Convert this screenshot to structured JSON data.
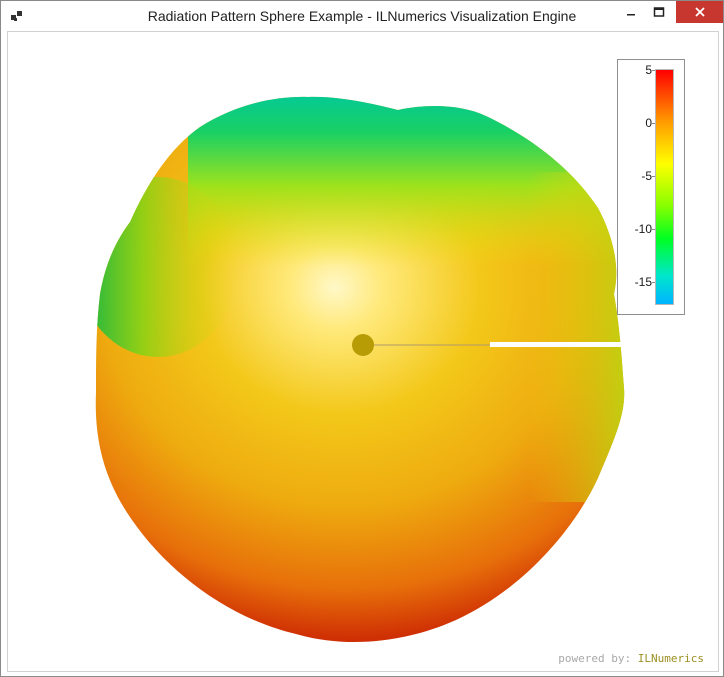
{
  "window": {
    "title": "Radiation Pattern Sphere Example - ILNumerics Visualization Engine",
    "app_icon": "app-icon",
    "buttons": {
      "minimize_icon": "minimize-icon",
      "maximize_icon": "maximize-icon",
      "close_icon": "close-icon"
    }
  },
  "colorbar": {
    "ticks": [
      "5",
      "0",
      "-5",
      "-10",
      "-15"
    ],
    "range": [
      -17,
      5
    ],
    "colormap": [
      "#00b4ff",
      "#00e6cc",
      "#00ff22",
      "#88ff00",
      "#ffff00",
      "#ff9a00",
      "#ff0000"
    ]
  },
  "branding": {
    "prefix": "powered by:",
    "name": "ILNumerics"
  },
  "colors": {
    "close_button": "#c7372f",
    "center_marker": "#b89c05"
  }
}
